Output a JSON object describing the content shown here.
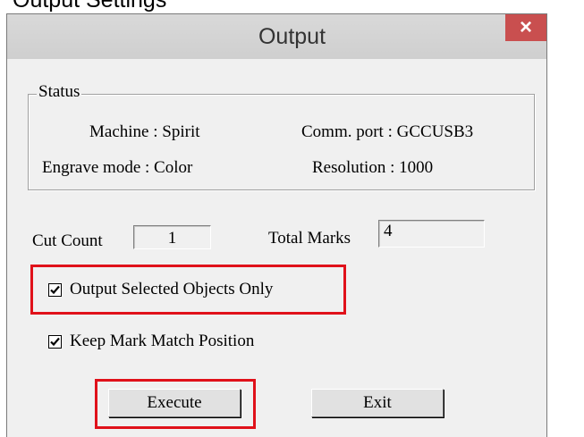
{
  "caption": "Output Settings",
  "dialog": {
    "title": "Output",
    "close_glyph": "×",
    "colors": {
      "close_button": "#c94f4f",
      "highlight": "#e0111a"
    }
  },
  "status": {
    "legend": "Status",
    "machine_label": "Machine :",
    "machine_value": "Spirit",
    "comm_label": "Comm. port :",
    "comm_value": "GCCUSB3",
    "engrave_label": "Engrave mode :",
    "engrave_value": "Color",
    "resolution_label": "Resolution :",
    "resolution_value": "1000"
  },
  "counts": {
    "cut_label": "Cut Count",
    "cut_value": "1",
    "marks_label": "Total Marks",
    "marks_value": "4"
  },
  "options": {
    "output_selected_label": "Output Selected Objects Only",
    "output_selected_checked": true,
    "keep_mark_label": "Keep Mark Match Position",
    "keep_mark_checked": true
  },
  "buttons": {
    "execute": "Execute",
    "exit": "Exit"
  }
}
